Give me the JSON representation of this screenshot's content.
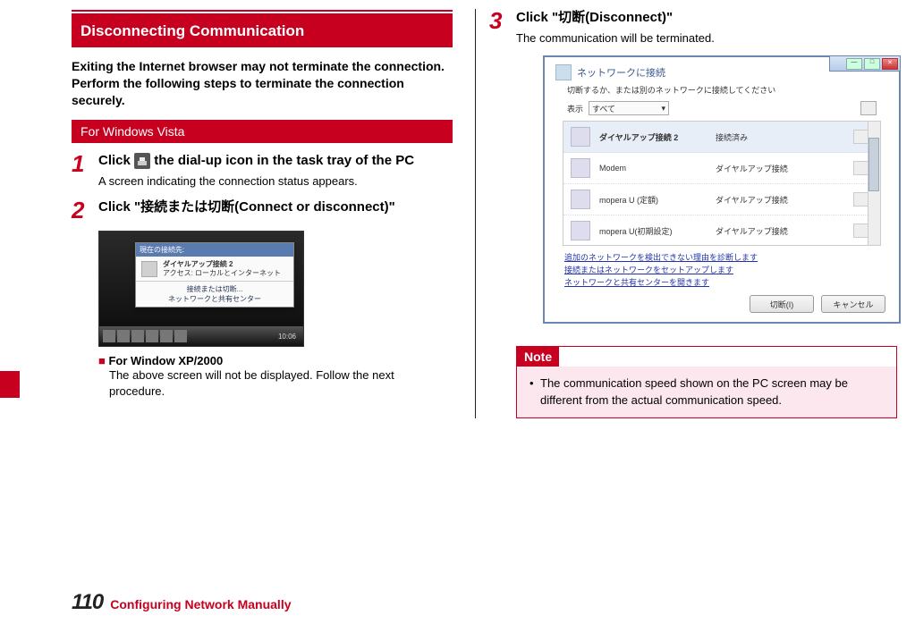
{
  "section_title": "Disconnecting Communication",
  "intro": "Exiting the Internet browser may not terminate the connection. Perform the following steps to terminate the connection securely.",
  "subhead": "For Windows Vista",
  "steps": {
    "s1": {
      "num": "1",
      "title_a": "Click ",
      "title_b": " the dial-up icon in the task tray of the PC",
      "desc": "A screen indicating the connection status appears."
    },
    "s2": {
      "num": "2",
      "title": "Click \"接続または切断(Connect or disconnect)\""
    },
    "s3": {
      "num": "3",
      "title": "Click \"切断(Disconnect)\"",
      "desc": "The communication will be terminated."
    }
  },
  "popup_small": {
    "header": "現在の接続先:",
    "conn_name": "ダイヤルアップ接続 2",
    "conn_sub": "アクセス: ローカルとインターネット",
    "link1": "接続または切断...",
    "link2": "ネットワークと共有センター",
    "time": "10:06"
  },
  "sub_note": {
    "title": "For Window XP/2000",
    "body": "The above screen will not be displayed. Follow the next procedure."
  },
  "popup_big": {
    "header": "ネットワークに接続",
    "msg": "切断するか、または別のネットワークに接続してください",
    "show_lbl": "表示",
    "show_val": "すべて",
    "items": [
      {
        "name": "ダイヤルアップ接続 2",
        "status": "接続済み",
        "bold": true
      },
      {
        "name": "Modem",
        "status": "ダイヤルアップ接続"
      },
      {
        "name": "mopera U (定額)",
        "status": "ダイヤルアップ接続"
      },
      {
        "name": "mopera U(初期設定)",
        "status": "ダイヤルアップ接続"
      }
    ],
    "link1": "追加のネットワークを検出できない理由を診断します",
    "link2": "接続またはネットワークをセットアップします",
    "link3": "ネットワークと共有センターを開きます",
    "btn1": "切断(I)",
    "btn2": "キャンセル"
  },
  "note": {
    "head": "Note",
    "item": "The communication speed shown on the PC screen may be different from the actual communication speed."
  },
  "footer": {
    "page": "110",
    "label": "Configuring Network Manually"
  }
}
